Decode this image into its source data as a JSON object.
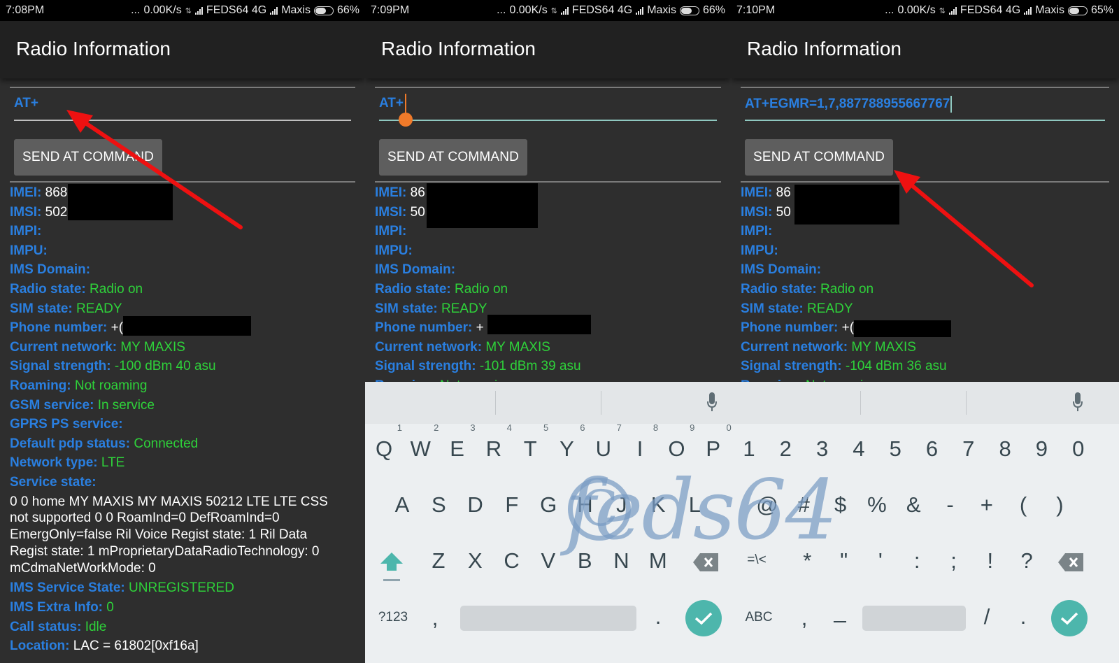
{
  "screens": [
    {
      "status": {
        "time": "7:08PM",
        "dots": "...",
        "speed": "0.00K/s",
        "carrier1": "FEDS64 4G",
        "carrier2": "Maxis",
        "battery": "66%",
        "battery_level": 0.66
      },
      "title": "Radio Information",
      "at_input": "AT+",
      "send_label": "SEND AT COMMAND",
      "imei_prefix": "868",
      "imsi_prefix": "502",
      "phone_prefix": "+(",
      "signal": "-100 dBm   40 asu"
    },
    {
      "status": {
        "time": "7:09PM",
        "dots": "...",
        "speed": "0.00K/s",
        "carrier1": "FEDS64 4G",
        "carrier2": "Maxis",
        "battery": "66%",
        "battery_level": 0.66
      },
      "title": "Radio Information",
      "at_input": "AT+",
      "send_label": "SEND AT COMMAND",
      "imei_prefix": "86",
      "imsi_prefix": "50",
      "phone_prefix": "+",
      "signal": "-101 dBm   39 asu"
    },
    {
      "status": {
        "time": "7:10PM",
        "dots": "...",
        "speed": "0.00K/s",
        "carrier1": "FEDS64 4G",
        "carrier2": "Maxis",
        "battery": "65%",
        "battery_level": 0.65
      },
      "title": "Radio Information",
      "at_input": "AT+EGMR=1,7,887788955667767",
      "send_label": "SEND AT COMMAND",
      "imei_prefix": "86",
      "imsi_prefix": "50",
      "phone_prefix": "+(",
      "signal": "-104 dBm   36 asu"
    }
  ],
  "labels": {
    "imei": "IMEI:",
    "imsi": "IMSI:",
    "impi": "IMPI:",
    "impu": "IMPU:",
    "ims_domain": "IMS Domain:",
    "radio_state": "Radio state:",
    "sim_state": "SIM state:",
    "phone_number": "Phone number:",
    "current_network": "Current network:",
    "signal_strength": "Signal strength:",
    "roaming": "Roaming:",
    "gsm_service": "GSM service:",
    "gprs_service": "GPRS PS service:",
    "default_pdp": "Default pdp status:",
    "network_type": "Network type:",
    "service_state": "Service state:",
    "ims_service_state": "IMS Service State:",
    "ims_extra_info": "IMS Extra Info:",
    "call_status": "Call status:",
    "location": "Location:"
  },
  "values": {
    "radio_state": "Radio on",
    "sim_state": "READY",
    "current_network": "MY MAXIS",
    "roaming": "Not roaming",
    "gsm_service": "In service",
    "default_pdp": "Connected",
    "network_type": "LTE",
    "service_state": "0 0 home MY MAXIS MY MAXIS 50212  LTE LTE CSS not supported 0 0 RoamInd=0 DefRoamInd=0 EmergOnly=false Ril Voice Regist state: 1 Ril Data Regist state: 1 mProprietaryDataRadioTechnology: 0 mCdmaNetWorkMode: 0",
    "ims_service_state": "UNREGISTERED",
    "ims_extra_info": "0",
    "call_status": "Idle",
    "location": "LAC = 61802[0xf16a]"
  },
  "keyboard": {
    "letters_row1": [
      {
        "key": "Q",
        "hint": "1"
      },
      {
        "key": "W",
        "hint": "2"
      },
      {
        "key": "E",
        "hint": "3"
      },
      {
        "key": "R",
        "hint": "4"
      },
      {
        "key": "T",
        "hint": "5"
      },
      {
        "key": "Y",
        "hint": "6"
      },
      {
        "key": "U",
        "hint": "7"
      },
      {
        "key": "I",
        "hint": "8"
      },
      {
        "key": "O",
        "hint": "9"
      },
      {
        "key": "P",
        "hint": "0"
      }
    ],
    "letters_row2": [
      "A",
      "S",
      "D",
      "F",
      "G",
      "H",
      "J",
      "K",
      "L"
    ],
    "letters_row3": [
      "Z",
      "X",
      "C",
      "V",
      "B",
      "N",
      "M"
    ],
    "letters_bottom": {
      "symbols_key": "?123",
      "comma": ",",
      "period": "."
    },
    "symbols_row1": [
      "1",
      "2",
      "3",
      "4",
      "5",
      "6",
      "7",
      "8",
      "9",
      "0"
    ],
    "symbols_row2": [
      "@",
      "#",
      "$",
      "%",
      "&",
      "-",
      "+",
      "(",
      ")"
    ],
    "symbols_row3": [
      "=\\<",
      "*",
      "\"",
      "'",
      ":",
      ";",
      "!",
      "?"
    ],
    "symbols_bottom": {
      "abc_key": "ABC",
      "comma": ",",
      "underscore": "_",
      "slash": "/",
      "period": "."
    },
    "accent_color": "#4db6ac"
  },
  "watermark": "feds64",
  "colors": {
    "label_blue": "#2a7fe0",
    "value_green": "#2ed23a",
    "annotation_red": "#ee1111",
    "cursor_orange": "#f07a2a"
  }
}
